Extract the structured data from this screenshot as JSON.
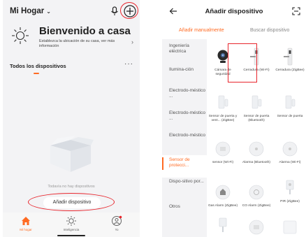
{
  "left": {
    "home_title": "Mi Hogar",
    "home_chevron": "⌄",
    "welcome_title": "Bienvenido a casa",
    "welcome_sub": "Establezca la ubicación de su casa, ver más información",
    "welcome_arrow": "›",
    "devices_label": "Todos los dispositivos",
    "more_dots": "···",
    "empty_text": "Todavía no hay dispositivos",
    "add_button": "Añadir dispositivo",
    "tabs": [
      {
        "label": "Mi hogar",
        "icon": "home-icon"
      },
      {
        "label": "Inteligencia",
        "icon": "sun-icon"
      },
      {
        "label": "Yo",
        "icon": "user-icon"
      }
    ],
    "accent": "#ff6a22",
    "highlight": "#e8262d"
  },
  "right": {
    "title": "Añadir dispositivo",
    "tab_manual": "Añadir manualmente",
    "tab_search": "Buscar dispositivo",
    "categories": [
      "Ingeniería eléctrica",
      "Ilumina-ción",
      "Electrodo-méstico ...",
      "Electrodo-méstico ...",
      "Electrodo-méstico",
      "Sensor de protecci...",
      "Dispo-sitivo por...",
      "Otros"
    ],
    "active_category_index": 5,
    "devices": [
      {
        "name": "Cámara de seguridad",
        "icon": "camera-icon"
      },
      {
        "name": "Cerradura (Wi-Fi)",
        "icon": "lock-icon"
      },
      {
        "name": "Cerradura (ZigBee)",
        "icon": "lock-icon"
      },
      {
        "name": "Sensor de puerta y vent... (ZigBee)",
        "icon": "door-sensor-icon"
      },
      {
        "name": "Sensor de puerta (Bluetooth)",
        "icon": "door-sensor-icon"
      },
      {
        "name": "Sensor de puerta",
        "icon": "door-sensor-icon"
      },
      {
        "name": "sensor (Wi-Fi)",
        "icon": "sensor-icon"
      },
      {
        "name": "Alarma (Bluetooth)",
        "icon": "alarm-icon"
      },
      {
        "name": "Alarma (Wi-Fi)",
        "icon": "alarm-icon"
      },
      {
        "name": "Gas Alarm (ZigBee)",
        "icon": "gas-icon"
      },
      {
        "name": "CO Alarm (ZigBee)",
        "icon": "co-icon"
      },
      {
        "name": "PIR (ZigBee)",
        "icon": "pir-icon"
      }
    ]
  }
}
